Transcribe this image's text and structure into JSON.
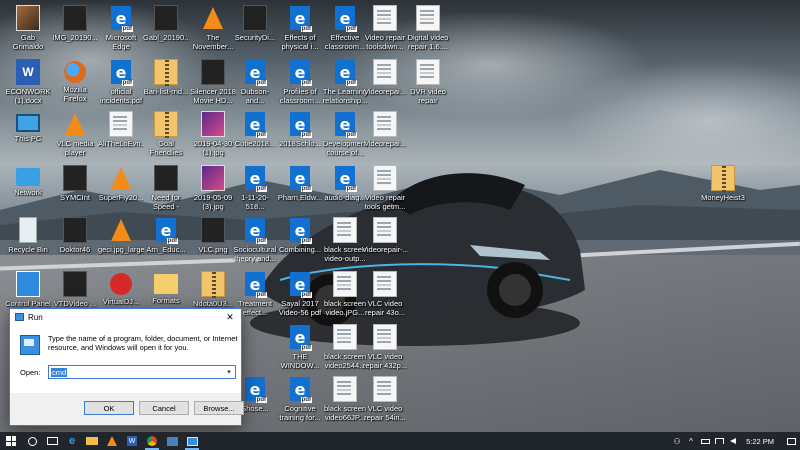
{
  "desktop": {
    "icons": [
      {
        "id": "i1",
        "label": "Gab Grimaldo",
        "type": "photo"
      },
      {
        "id": "i2",
        "label": "IMG_20190...",
        "type": "dark"
      },
      {
        "id": "i3",
        "label": "Microsoft Edge",
        "type": "edge-app"
      },
      {
        "id": "i4",
        "label": "Gab|_20190...",
        "type": "dark"
      },
      {
        "id": "i5",
        "label": "The November...",
        "type": "vlc"
      },
      {
        "id": "i6",
        "label": "SecurityDi...",
        "type": "dark"
      },
      {
        "id": "i7",
        "label": "Effects of physical i...",
        "type": "edge"
      },
      {
        "id": "i8",
        "label": "Effective classroom...",
        "type": "edge"
      },
      {
        "id": "i9",
        "label": "Video repair toolsdiwn...",
        "type": "doc"
      },
      {
        "id": "i10",
        "label": "Digital video repair 1.6....",
        "type": "doc"
      },
      {
        "id": "i11",
        "label": "ECONWORK (1).docx",
        "type": "word"
      },
      {
        "id": "i12",
        "label": "Mozilla Firefox",
        "type": "firefox"
      },
      {
        "id": "i13",
        "label": "official incidents.pdf",
        "type": "edge"
      },
      {
        "id": "i14",
        "label": "Bari-list-rnd...",
        "type": "zip"
      },
      {
        "id": "i15",
        "label": "Silencer 2018 Movie HD...",
        "type": "dark"
      },
      {
        "id": "i16",
        "label": "Dubson-and...",
        "type": "edge"
      },
      {
        "id": "i17",
        "label": "Profiles of classroom...",
        "type": "edge"
      },
      {
        "id": "i18",
        "label": "The Learning relationship...",
        "type": "edge"
      },
      {
        "id": "i19",
        "label": "Videorepai...",
        "type": "doc"
      },
      {
        "id": "i20",
        "label": "DVR video repair menu...",
        "type": "doc"
      },
      {
        "id": "i21",
        "label": "This PC",
        "type": "pc"
      },
      {
        "id": "i22",
        "label": "VLC media player",
        "type": "vlc"
      },
      {
        "id": "i23",
        "label": "AllTheLoEvn...",
        "type": "doc"
      },
      {
        "id": "i24",
        "label": "Goal Friendlies Mc...srt",
        "type": "zip"
      },
      {
        "id": "i25",
        "label": "2019-04-30 (1).jpg",
        "type": "purple"
      },
      {
        "id": "i26",
        "label": "Cutie2018...",
        "type": "edge"
      },
      {
        "id": "i27",
        "label": "2018Schlo...",
        "type": "edge"
      },
      {
        "id": "i28",
        "label": "Development course of...",
        "type": "edge"
      },
      {
        "id": "i29",
        "label": "Videorepai...",
        "type": "doc"
      },
      {
        "id": "i30",
        "label": "Network",
        "type": "net"
      },
      {
        "id": "i31",
        "label": "SYMCInt",
        "type": "dark"
      },
      {
        "id": "i32",
        "label": "SuperFly20...",
        "type": "vlc"
      },
      {
        "id": "i33",
        "label": "Need for Speed - Mos...",
        "type": "dark"
      },
      {
        "id": "i34",
        "label": "2019-05-09 (3).jpg",
        "type": "purple"
      },
      {
        "id": "i35",
        "label": "1-11-20-518...",
        "type": "edge"
      },
      {
        "id": "i36",
        "label": "Pharn,Eldw...",
        "type": "edge"
      },
      {
        "id": "i37",
        "label": "audio-diag...",
        "type": "edge"
      },
      {
        "id": "i38",
        "label": "Video repair tools getm...",
        "type": "doc"
      },
      {
        "id": "i39",
        "label": "MoneyHeist3",
        "type": "zip"
      },
      {
        "id": "i40",
        "label": "Recycle Bin",
        "type": "bin"
      },
      {
        "id": "i41",
        "label": "Doktor46",
        "type": "dark"
      },
      {
        "id": "i42",
        "label": "geci.jpg_large",
        "type": "vlc"
      },
      {
        "id": "i43",
        "label": "Arn_Educ...",
        "type": "edge"
      },
      {
        "id": "i44",
        "label": "VLC.png",
        "type": "dark"
      },
      {
        "id": "i45",
        "label": "Sociocultural theory and...",
        "type": "edge"
      },
      {
        "id": "i46",
        "label": "Combining...",
        "type": "edge"
      },
      {
        "id": "i47",
        "label": "black screen video-outp...",
        "type": "doc"
      },
      {
        "id": "i48",
        "label": "Videorepair-...",
        "type": "doc"
      },
      {
        "id": "i49",
        "label": "Control Panel",
        "type": "cp"
      },
      {
        "id": "i50",
        "label": "VTDVideo ...",
        "type": "dark"
      },
      {
        "id": "i51",
        "label": "VirtualDJ...",
        "type": "red"
      },
      {
        "id": "i52",
        "label": "Formats",
        "type": "folder"
      },
      {
        "id": "i53",
        "label": "Ndota0U3...",
        "type": "zip"
      },
      {
        "id": "i54",
        "label": "Treatment effect...",
        "type": "edge"
      },
      {
        "id": "i55",
        "label": "Sayal 2017 Video-56 pdf",
        "type": "edge"
      },
      {
        "id": "i56",
        "label": "black screen video.jPG...",
        "type": "doc"
      },
      {
        "id": "i57",
        "label": "VLC video repair 43o...",
        "type": "doc"
      },
      {
        "id": "i58",
        "label": "THE WINDOW...",
        "type": "edge"
      },
      {
        "id": "i59",
        "label": "black screen video2544...",
        "type": "doc"
      },
      {
        "id": "i60",
        "label": "VLC video repair 432p...",
        "type": "doc"
      },
      {
        "id": "i61",
        "label": "Shose...",
        "type": "edge"
      },
      {
        "id": "i62",
        "label": "Cognitive training for...",
        "type": "edge"
      },
      {
        "id": "i63",
        "label": "black screen video66JP...",
        "type": "doc"
      },
      {
        "id": "i64",
        "label": "VLC video repair 54in...",
        "type": "doc"
      }
    ]
  },
  "run_dialog": {
    "title": "Run",
    "close_glyph": "✕",
    "description": "Type the name of a program, folder, document, or Internet resource, and Windows will open it for you.",
    "open_label": "Open:",
    "open_value": "cmd",
    "dropdown_glyph": "▾",
    "ok_label": "OK",
    "cancel_label": "Cancel",
    "browse_label": "Browse..."
  },
  "taskbar": {
    "apps": [
      "start-icon",
      "search-icon",
      "task-view-icon",
      "edge-icon",
      "file-explorer-icon",
      "vlc-icon",
      "word-icon",
      "chrome-icon",
      "photos-icon",
      "run-icon"
    ],
    "edge_glyph": "e",
    "word_glyph": "W",
    "tray": {
      "people_glyph": "⚇",
      "chevron_glyph": "^",
      "time": "5:22 PM"
    }
  }
}
